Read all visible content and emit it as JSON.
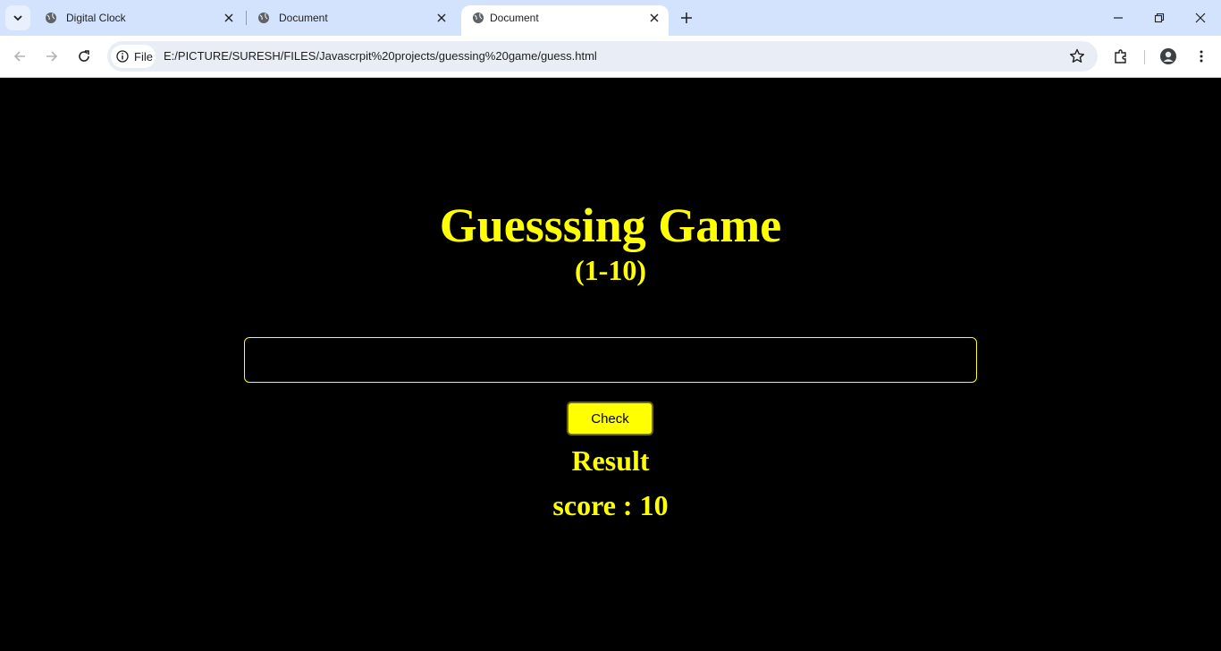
{
  "browser": {
    "tabs": [
      {
        "title": "Digital Clock",
        "active": false
      },
      {
        "title": "Document",
        "active": false
      },
      {
        "title": "Document",
        "active": true
      }
    ],
    "site_info_label": "File",
    "url": "E:/PICTURE/SURESH/FILES/Javascrpit%20projects/guessing%20game/guess.html"
  },
  "page": {
    "title": "Guesssing Game",
    "range": "(1-10)",
    "guess_input": {
      "value": "",
      "placeholder": ""
    },
    "check_label": "Check",
    "result_text": "Result",
    "score_text": "score : 10"
  },
  "colors": {
    "page_background": "#000000",
    "accent": "#ffff00",
    "tabstrip": "#d3e3fd"
  }
}
